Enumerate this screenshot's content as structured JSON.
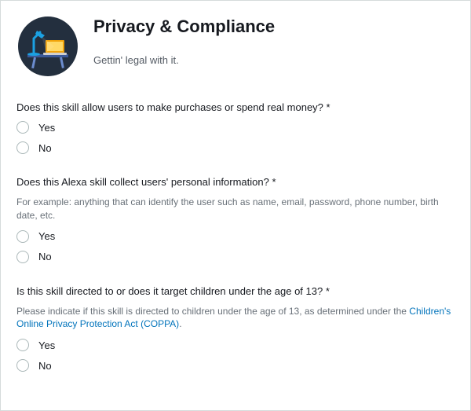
{
  "header": {
    "title": "Privacy & Compliance",
    "subtitle": "Gettin' legal with it."
  },
  "questions": [
    {
      "label": "Does this skill allow users to make purchases or spend real money? *",
      "helper": null,
      "link_text": null,
      "options": [
        "Yes",
        "No"
      ]
    },
    {
      "label": "Does this Alexa skill collect users' personal information? *",
      "helper": "For example: anything that can identify the user such as name, email, password, phone number, birth date, etc.",
      "link_text": null,
      "options": [
        "Yes",
        "No"
      ]
    },
    {
      "label": "Is this skill directed to or does it target children under the age of 13? *",
      "helper": "Please indicate if this skill is directed to children under the age of 13, as determined under the ",
      "link_text": "Children's Online Privacy Protection Act (COPPA)",
      "options": [
        "Yes",
        "No"
      ]
    }
  ]
}
